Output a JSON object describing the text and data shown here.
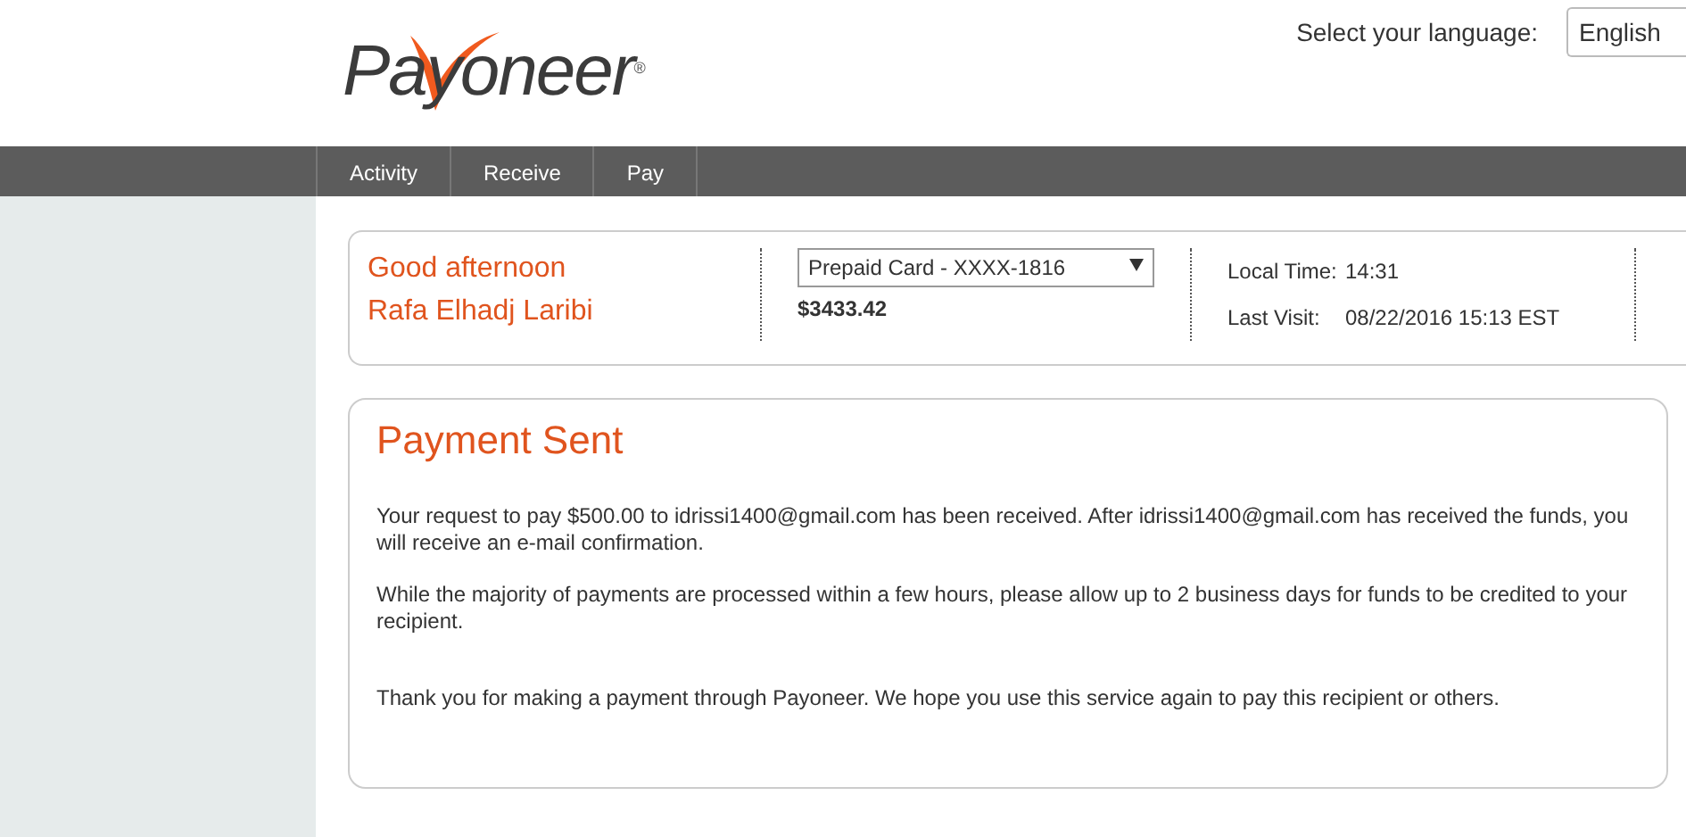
{
  "logo": {
    "text": "Payoneer",
    "registered": "®"
  },
  "language": {
    "label": "Select your language:",
    "value": "English"
  },
  "nav": [
    {
      "label": "Activity"
    },
    {
      "label": "Receive"
    },
    {
      "label": "Pay"
    }
  ],
  "account": {
    "greeting": "Good afternoon",
    "name": "Rafa Elhadj Laribi",
    "card": "Prepaid Card - XXXX-1816",
    "balance": "$3433.42",
    "details": [
      {
        "label": "Local Time:",
        "value": "14:31"
      },
      {
        "label": "Last Visit:",
        "value": "08/22/2016 15:13 EST"
      }
    ]
  },
  "message": {
    "title": "Payment Sent",
    "paragraphs": [
      "Your request to pay $500.00 to idrissi1400@gmail.com has been received. After idrissi1400@gmail.com has received the funds, you will receive an e-mail confirmation.",
      "While the majority of payments are processed within a few hours, please allow up to 2 business days for funds to be credited to your recipient.",
      "Thank you for making a payment through Payoneer. We hope you use this service again to pay this recipient or others."
    ]
  }
}
